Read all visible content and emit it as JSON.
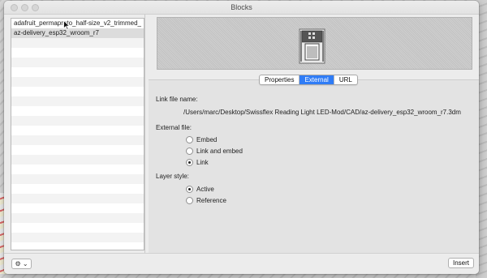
{
  "window": {
    "title": "Blocks"
  },
  "blocks_list": {
    "items": [
      "adafruit_permaproto_half-size_v2_trimmed_",
      "az-delivery_esp32_wroom_r7"
    ],
    "selected_index": 1
  },
  "tabs": [
    {
      "label": "Properties",
      "active": false
    },
    {
      "label": "External",
      "active": true
    },
    {
      "label": "URL",
      "active": false
    }
  ],
  "external": {
    "link_file_name_label": "Link file name:",
    "link_file_path": "/Users/marc/Desktop/Swissflex Reading Light LED-Mod/CAD/az-delivery_esp32_wroom_r7.3dm",
    "external_file_label": "External file:",
    "external_file_options": [
      {
        "label": "Embed",
        "selected": false
      },
      {
        "label": "Link and embed",
        "selected": false
      },
      {
        "label": "Link",
        "selected": true
      }
    ],
    "layer_style_label": "Layer style:",
    "layer_style_options": [
      {
        "label": "Active",
        "selected": true
      },
      {
        "label": "Reference",
        "selected": false
      }
    ]
  },
  "bottom_bar": {
    "gear_menu_label": "⚙ ⌄",
    "insert_label": "Insert"
  },
  "colors": {
    "accent": "#2f7cf6",
    "window_bg": "#ececec"
  },
  "icons": [
    "gear-icon",
    "cursor-icon"
  ]
}
